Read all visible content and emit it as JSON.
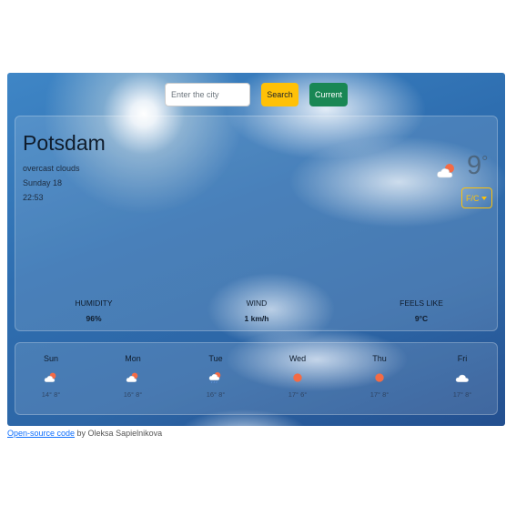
{
  "search": {
    "placeholder": "Enter the city",
    "search_label": "Search",
    "current_label": "Current"
  },
  "current": {
    "city": "Potsdam",
    "description": "overcast clouds",
    "date": "Sunday 18",
    "time": "22:53",
    "temperature": "9",
    "temp_unit": "°",
    "unit_toggle_label": "F/C",
    "icon": "cloud-sun-icon"
  },
  "stats": [
    {
      "label": "Humidity",
      "value": "96%"
    },
    {
      "label": "Wind",
      "value": "1 km/h"
    },
    {
      "label": "Feels like",
      "value": "9°C"
    }
  ],
  "forecast": [
    {
      "day": "Sun",
      "temps": "14° 8°",
      "icon": "cloud-sun-icon"
    },
    {
      "day": "Mon",
      "temps": "16° 8°",
      "icon": "cloud-sun-icon"
    },
    {
      "day": "Tue",
      "temps": "16° 8°",
      "icon": "cloud-rain-icon"
    },
    {
      "day": "Wed",
      "temps": "17° 6°",
      "icon": "sun-icon"
    },
    {
      "day": "Thu",
      "temps": "17° 8°",
      "icon": "sun-icon"
    },
    {
      "day": "Fri",
      "temps": "17° 8°",
      "icon": "cloud-icon"
    }
  ],
  "footer": {
    "link_text": "Open-source code",
    "by_text": " by Oleksa Sapielnikova"
  },
  "colors": {
    "search_button": "#ffc107",
    "current_button": "#198754",
    "unit_toggle": "#ffc107",
    "link": "#0d6efd",
    "sun": "#f46b45"
  }
}
